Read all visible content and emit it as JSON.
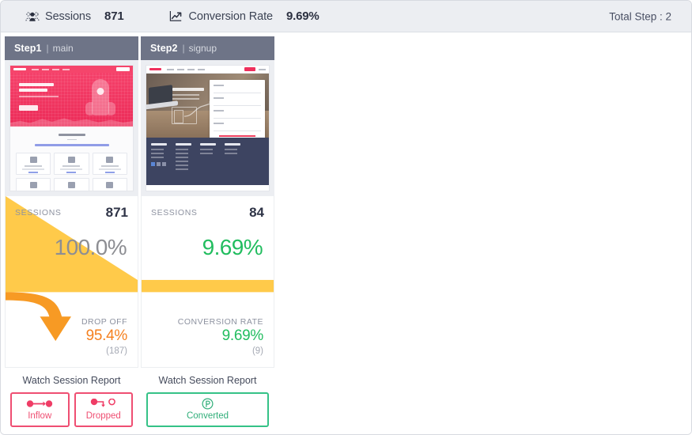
{
  "topbar": {
    "sessions": {
      "icon": "users-group-icon",
      "label": "Sessions",
      "value": "871"
    },
    "conversion": {
      "icon": "line-chart-up-icon",
      "label": "Conversion Rate",
      "value": "9.69%"
    },
    "total_step": "Total Step : 2"
  },
  "colors": {
    "header_bar": "#eceef2",
    "step_header": "#6e7487",
    "funnel_yellow": "#ffca4a",
    "arrow_orange": "#f68b1f",
    "drop_off": "#f5801f",
    "conversion_green": "#22bd5f",
    "inflow_pink": "#ef4e72",
    "converted_green": "#35c287"
  },
  "steps": [
    {
      "name": "Step1",
      "separator": "|",
      "page": "main",
      "thumbnail_alt": "main-landing-page-thumbnail",
      "sessions_label": "SESSIONS",
      "sessions_value": "871",
      "percent": "100.0%",
      "percent_style": "grey",
      "rate_label": "DROP OFF",
      "rate_value": "95.4%",
      "rate_style": "orange",
      "rate_count": "(187)",
      "watch_title": "Watch Session Report",
      "buttons": [
        {
          "icon": "inflow-arrow-icon",
          "label": "Inflow",
          "style": "pink"
        },
        {
          "icon": "dropped-arrow-icon",
          "label": "Dropped",
          "style": "pink"
        }
      ]
    },
    {
      "name": "Step2",
      "separator": "|",
      "page": "signup",
      "thumbnail_alt": "signup-page-thumbnail",
      "sessions_label": "SESSIONS",
      "sessions_value": "84",
      "percent": "9.69%",
      "percent_style": "green",
      "rate_label": "CONVERSION RATE",
      "rate_value": "9.69%",
      "rate_style": "green",
      "rate_count": "(9)",
      "watch_title": "Watch Session Report",
      "buttons": [
        {
          "icon": "converted-p-icon",
          "label": "Converted",
          "style": "green"
        }
      ]
    }
  ],
  "chart_data": {
    "type": "funnel",
    "title": "Conversion funnel",
    "steps": [
      "Step1 | main",
      "Step2 | signup"
    ],
    "sessions": [
      871,
      84
    ],
    "percent_of_first": [
      100.0,
      9.69
    ],
    "drop_off_percent": [
      95.4,
      null
    ],
    "drop_off_count": [
      187,
      null
    ],
    "conversion_rate_percent": [
      null,
      9.69
    ],
    "conversion_count": [
      null,
      9
    ],
    "total_steps": 2,
    "overall_conversion_rate": 9.69,
    "total_sessions": 871
  }
}
